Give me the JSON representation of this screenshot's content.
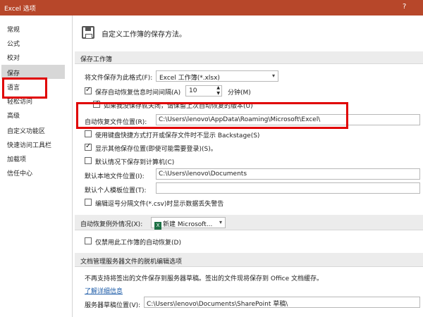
{
  "window": {
    "title": "Excel 选项",
    "help": "?"
  },
  "sidebar": {
    "items": [
      {
        "label": "常规"
      },
      {
        "label": "公式"
      },
      {
        "label": "校对"
      },
      {
        "label": "保存"
      },
      {
        "label": "语言"
      },
      {
        "label": "轻松访问"
      },
      {
        "label": "高级"
      },
      {
        "label": "自定义功能区"
      },
      {
        "label": "快速访问工具栏"
      },
      {
        "label": "加载项"
      },
      {
        "label": "信任中心"
      }
    ],
    "selected": "保存"
  },
  "main": {
    "intro": "自定义工作簿的保存方法。",
    "save_section": {
      "title": "保存工作簿",
      "format_label": "将文件保存为此格式(F):",
      "format_value": "Excel 工作簿(*.xlsx)",
      "autorecover_label": "保存自动恢复信息时间间隔(A)",
      "autorecover_checked": true,
      "autorecover_minutes": "10",
      "minutes_label": "分钟(M)",
      "keep_last_label": "如果我没保存就关闭，请保留上次自动恢复的版本(U)",
      "keep_last_checked": true,
      "autorecover_location_label": "自动恢复文件位置(R):",
      "autorecover_location_value": "C:\\Users\\lenovo\\AppData\\Roaming\\Microsoft\\Excel\\",
      "backstage_label": "使用键盘快捷方式打开或保存文件时不显示 Backstage(S)",
      "backstage_checked": false,
      "show_locations_label": "显示其他保存位置(即使可能需要登录)(S)。",
      "show_locations_checked": true,
      "save_to_computer_label": "默认情况下保存到计算机(C)",
      "save_to_computer_checked": false,
      "local_location_label": "默认本地文件位置(I):",
      "local_location_value": "C:\\Users\\lenovo\\Documents",
      "personal_templates_label": "默认个人模板位置(T):",
      "personal_templates_value": "",
      "csv_label": "编辑逗号分隔文件(*.csv)时显示数据丢失警告",
      "csv_checked": false
    },
    "exceptions_section": {
      "title_label": "自动恢复例外情况(X):",
      "workbook_value": "新建 Microsoft...",
      "disable_label": "仅禁用此工作簿的自动恢复(D)",
      "disable_checked": false
    },
    "offline_section": {
      "title": "文档管理服务器文件的脱机编辑选项",
      "note": "不再支持将签出的文件保存到服务器草稿。签出的文件现将保存到 Office 文档缓存。",
      "learn_more": "了解详细信息",
      "drafts_label": "服务器草稿位置(V):",
      "drafts_value": "C:\\Users\\lenovo\\Documents\\SharePoint 草稿\\"
    }
  },
  "colors": {
    "titlebar": "#b7472a",
    "highlight": "#e00000",
    "link": "#1e5ca8"
  }
}
